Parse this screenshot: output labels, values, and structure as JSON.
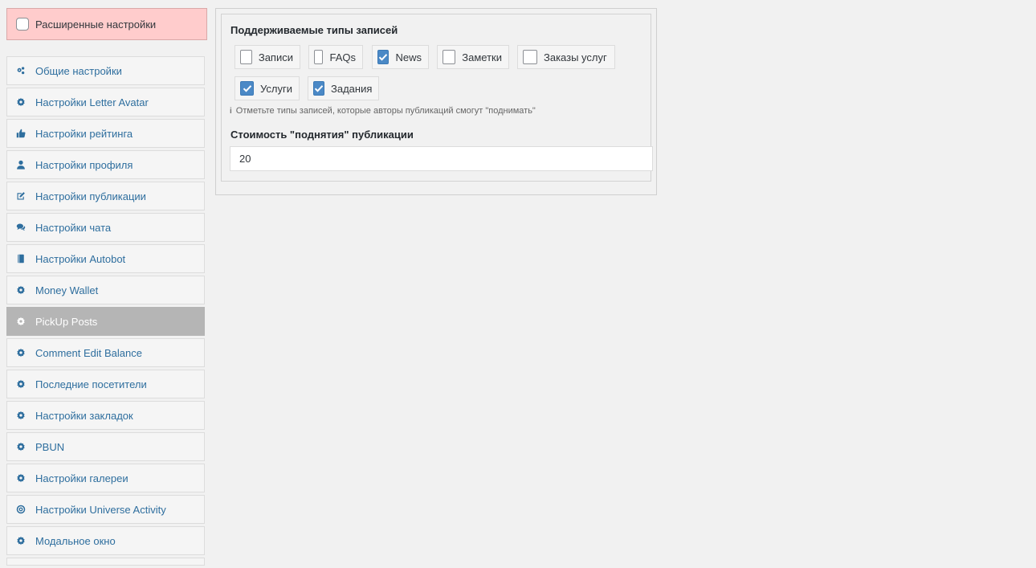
{
  "advanced": {
    "label": "Расширенные настройки",
    "checked": false
  },
  "sidebar": {
    "items": [
      {
        "label": "Общие настройки",
        "icon": "gears-icon"
      },
      {
        "label": "Настройки Letter Avatar",
        "icon": "gear-icon"
      },
      {
        "label": "Настройки рейтинга",
        "icon": "thumbs-up-icon"
      },
      {
        "label": "Настройки профиля",
        "icon": "user-icon"
      },
      {
        "label": "Настройки публикации",
        "icon": "edit-icon"
      },
      {
        "label": "Настройки чата",
        "icon": "comments-icon"
      },
      {
        "label": "Настройки Autobot",
        "icon": "book-icon"
      },
      {
        "label": "Money Wallet",
        "icon": "gear-icon"
      },
      {
        "label": "PickUp Posts",
        "icon": "gear-icon",
        "active": true
      },
      {
        "label": "Comment Edit Balance",
        "icon": "gear-icon"
      },
      {
        "label": "Последние посетители",
        "icon": "gear-icon"
      },
      {
        "label": "Настройки закладок",
        "icon": "gear-icon"
      },
      {
        "label": "PBUN",
        "icon": "gear-icon"
      },
      {
        "label": "Настройки галереи",
        "icon": "gear-icon"
      },
      {
        "label": "Настройки Universe Activity",
        "icon": "bullseye-icon"
      },
      {
        "label": "Модальное окно",
        "icon": "gear-icon"
      }
    ]
  },
  "post_types": {
    "title": "Поддерживаемые типы записей",
    "items": [
      {
        "label": "Записи",
        "checked": false
      },
      {
        "label": "FAQs",
        "checked": false
      },
      {
        "label": "News",
        "checked": true
      },
      {
        "label": "Заметки",
        "checked": false
      },
      {
        "label": "Заказы услуг",
        "checked": false
      },
      {
        "label": "Услуги",
        "checked": true
      },
      {
        "label": "Задания",
        "checked": true
      }
    ],
    "hint": "Отметьте типы записей, которые авторы публикаций смогут \"поднимать\""
  },
  "cost": {
    "title": "Стоимость \"поднятия\" публикации",
    "value": "20"
  },
  "colors": {
    "accent": "#2e6e9e",
    "checkbox_checked": "#4b89c6",
    "advanced_bg": "#ffcccc",
    "active_item_bg": "#b5b5b5"
  }
}
